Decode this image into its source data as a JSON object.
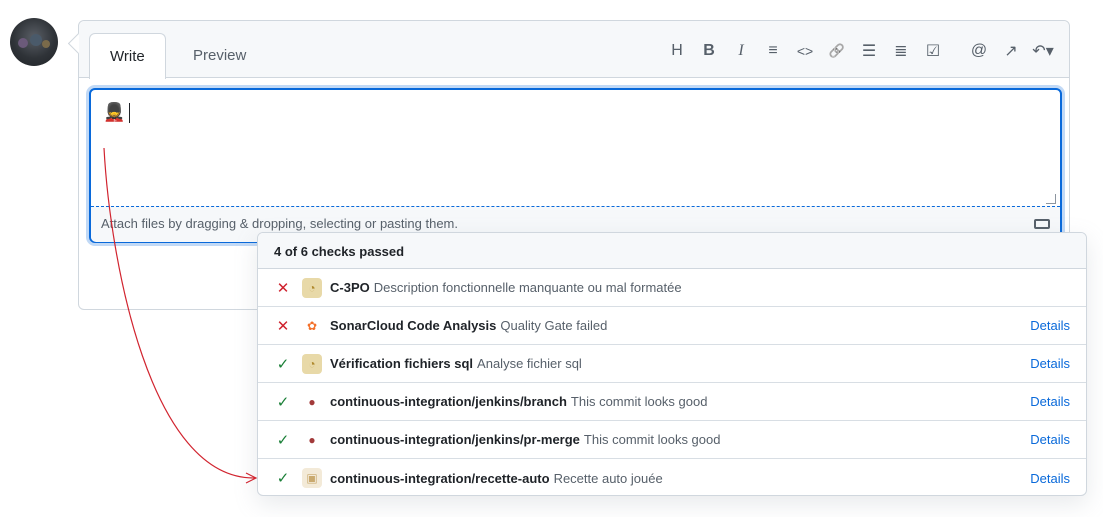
{
  "tabs": {
    "write": "Write",
    "preview": "Preview"
  },
  "toolbar": {
    "heading": "H",
    "bold": "B",
    "italic": "I",
    "quote": "≡",
    "code": "<>",
    "link": "🔗",
    "bullet_list": "☰",
    "numbered_list": "≣",
    "task_list": "☑",
    "mention": "@",
    "reference": "↗",
    "reply": "↶▾"
  },
  "editor": {
    "typed_emoji": "💂"
  },
  "attach": {
    "text": "Attach files by dragging & dropping, selecting or pasting them."
  },
  "checks": {
    "summary": "4 of 6 checks passed",
    "rows": [
      {
        "status": "✕",
        "state": "fail",
        "icon": "c3po-icon",
        "name": "C-3PO",
        "desc": "Description fonctionnelle manquante ou mal formatée",
        "details": ""
      },
      {
        "status": "✕",
        "state": "fail",
        "icon": "sonarcloud-icon",
        "name": "SonarCloud Code Analysis",
        "desc": "Quality Gate failed",
        "details": "Details"
      },
      {
        "status": "✓",
        "state": "ok",
        "icon": "c3po-icon",
        "name": "Vérification fichiers sql",
        "desc": "Analyse fichier sql",
        "details": "Details"
      },
      {
        "status": "✓",
        "state": "ok",
        "icon": "jenkins-icon",
        "name": "continuous-integration/jenkins/branch",
        "desc": "This commit looks good",
        "details": "Details"
      },
      {
        "status": "✓",
        "state": "ok",
        "icon": "jenkins-icon",
        "name": "continuous-integration/jenkins/pr-merge",
        "desc": "This commit looks good",
        "details": "Details"
      },
      {
        "status": "✓",
        "state": "ok",
        "icon": "recette-icon",
        "name": "continuous-integration/recette-auto",
        "desc": "Recette auto jouée",
        "details": "Details"
      }
    ]
  },
  "colors": {
    "accent": "#0969da",
    "fail": "#cf222e",
    "success": "#1a7f37",
    "arrow": "#d1242f"
  }
}
